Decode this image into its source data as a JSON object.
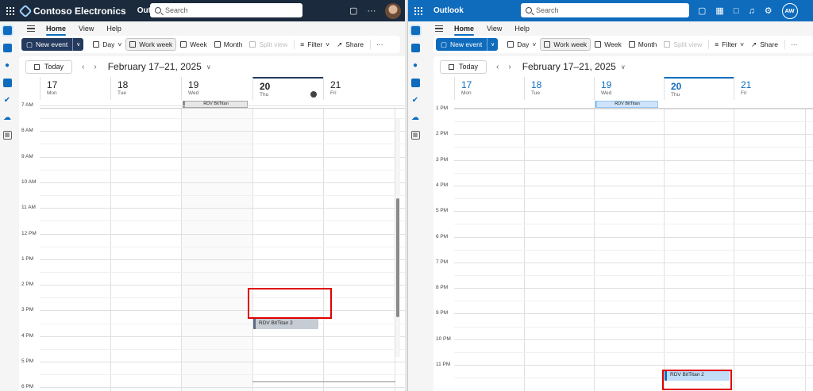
{
  "left": {
    "brand": "Contoso Electronics",
    "app": "Outlook",
    "search_placeholder": "Search",
    "icons": [
      "chat-icon",
      "more-icon"
    ],
    "more": "···",
    "menu": [
      "Home",
      "View",
      "Help"
    ],
    "toolbar": {
      "new_event": "New event",
      "day": "Day",
      "work_week": "Work week",
      "week": "Week",
      "month": "Month",
      "split_view": "Split view",
      "filter": "Filter",
      "share": "Share",
      "more": "···"
    },
    "today": "Today",
    "range": "February 17–21, 2025",
    "days": [
      {
        "num": "17",
        "name": "Mon"
      },
      {
        "num": "18",
        "name": "Tue"
      },
      {
        "num": "19",
        "name": "Wed"
      },
      {
        "num": "20",
        "name": "Thu"
      },
      {
        "num": "21",
        "name": "Fri"
      }
    ],
    "allday_event": "RDV BitTitan",
    "hours": [
      "7 AM",
      "8 AM",
      "9 AM",
      "10 AM",
      "11 AM",
      "12 PM",
      "1 PM",
      "2 PM",
      "3 PM",
      "4 PM",
      "5 PM",
      "6 PM"
    ],
    "event": "RDV BitTitan 2"
  },
  "right": {
    "app": "Outlook",
    "search_placeholder": "Search",
    "avatar": "AW",
    "menu": [
      "Home",
      "View",
      "Help"
    ],
    "toolbar": {
      "new_event": "New event",
      "day": "Day",
      "work_week": "Work week",
      "week": "Week",
      "month": "Month",
      "split_view": "Split view",
      "filter": "Filter",
      "share": "Share",
      "more": "···"
    },
    "today": "Today",
    "range": "February 17–21, 2025",
    "days": [
      {
        "num": "17",
        "name": "Mon"
      },
      {
        "num": "18",
        "name": "Tue"
      },
      {
        "num": "19",
        "name": "Wed"
      },
      {
        "num": "20",
        "name": "Thu"
      },
      {
        "num": "21",
        "name": "Fri"
      }
    ],
    "allday_event": "RDV BitTitan",
    "hours": [
      "1 PM",
      "2 PM",
      "3 PM",
      "4 PM",
      "5 PM",
      "6 PM",
      "7 PM",
      "8 PM",
      "9 PM",
      "10 PM",
      "11 PM"
    ],
    "event": "RDV BitTitan 2"
  },
  "colors": {
    "left_header": "#1b2a3d",
    "right_header": "#0f6cbd",
    "highlight": "#e00000"
  }
}
